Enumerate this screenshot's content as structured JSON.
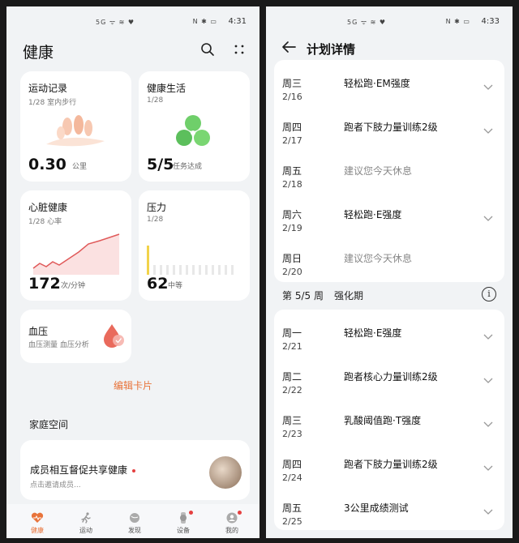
{
  "left": {
    "status": {
      "icons": "5G ᯤ ≋ ♥",
      "right_icons": "N ✱ ▭",
      "time": "4:31"
    },
    "title": "健康",
    "cards": {
      "exercise": {
        "title": "运动记录",
        "sub": "1/28 室内步行",
        "value": "0.30",
        "unit": "公里"
      },
      "life": {
        "title": "健康生活",
        "sub": "1/28",
        "value": "5/5",
        "unit": "任务达成"
      },
      "heart": {
        "title": "心脏健康",
        "sub": "1/28 心率",
        "value": "172",
        "unit": "次/分钟"
      },
      "stress": {
        "title": "压力",
        "sub": "1/28",
        "value": "62",
        "unit": "中等"
      },
      "bp": {
        "title": "血压",
        "sub": "血压测量 血压分析"
      }
    },
    "edit_label": "编辑卡片",
    "family": {
      "section": "家庭空间",
      "title": "成员相互督促共享健康",
      "sub": "点击邀请成员..."
    },
    "tabs": [
      {
        "label": "健康",
        "icon": "heart-icon"
      },
      {
        "label": "运动",
        "icon": "runner-icon"
      },
      {
        "label": "发现",
        "icon": "planet-icon"
      },
      {
        "label": "设备",
        "icon": "watch-icon"
      },
      {
        "label": "我的",
        "icon": "profile-icon"
      }
    ]
  },
  "right": {
    "status": {
      "icons": "5G ᯤ ≋ ♥",
      "right_icons": "N ✱ ▭",
      "time": "4:33"
    },
    "title": "计划详情",
    "week_a": [
      {
        "day": "周三",
        "date": "2/16",
        "plan": "轻松跑·EM强度",
        "rest": false
      },
      {
        "day": "周四",
        "date": "2/17",
        "plan": "跑者下肢力量训练2级",
        "rest": false
      },
      {
        "day": "周五",
        "date": "2/18",
        "plan": "建议您今天休息",
        "rest": true
      },
      {
        "day": "周六",
        "date": "2/19",
        "plan": "轻松跑·E强度",
        "rest": false
      },
      {
        "day": "周日",
        "date": "2/20",
        "plan": "建议您今天休息",
        "rest": true
      }
    ],
    "week_label": "第 5/5 周",
    "week_phase": "强化期",
    "week_b": [
      {
        "day": "周一",
        "date": "2/21",
        "plan": "轻松跑·E强度",
        "rest": false
      },
      {
        "day": "周二",
        "date": "2/22",
        "plan": "跑者核心力量训练2级",
        "rest": false
      },
      {
        "day": "周三",
        "date": "2/23",
        "plan": "乳酸阈值跑·T强度",
        "rest": false
      },
      {
        "day": "周四",
        "date": "2/24",
        "plan": "跑者下肢力量训练2级",
        "rest": false
      },
      {
        "day": "周五",
        "date": "2/25",
        "plan": "3公里成绩测试",
        "rest": false
      }
    ]
  }
}
